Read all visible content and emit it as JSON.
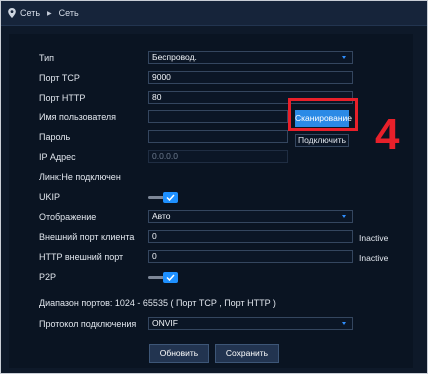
{
  "breadcrumb": {
    "icon": "location-pin-icon",
    "items": [
      "Сеть",
      "Сеть"
    ]
  },
  "form": {
    "type": {
      "label": "Тип",
      "value": "Беспровод."
    },
    "tcp_port": {
      "label": "Порт TCP",
      "value": "9000"
    },
    "http_port": {
      "label": "Порт HTTP",
      "value": "80"
    },
    "username": {
      "label": "Имя пользователя",
      "value": ""
    },
    "password": {
      "label": "Пароль",
      "value": ""
    },
    "ip_address": {
      "label": "IP Адрес",
      "value": "0.0.0.0"
    },
    "link_status": "Линк:Не подключен",
    "ukip": {
      "label": "UKIP",
      "enabled": true
    },
    "display": {
      "label": "Отображение",
      "value": "Авто"
    },
    "client_ext_port": {
      "label": "Внешний порт клиента",
      "value": "0",
      "status": "Inactive"
    },
    "http_ext_port": {
      "label": "HTTP внешний порт",
      "value": "0",
      "status": "Inactive"
    },
    "p2p": {
      "label": "P2P",
      "enabled": true
    },
    "port_range_note": "Диапазон портов: 1024 - 65535 ( Порт TCP , Порт HTTP )",
    "protocol": {
      "label": "Протокол подключения",
      "value": "ONVIF"
    }
  },
  "buttons": {
    "scan": "Сканирование",
    "connect": "Подключить",
    "refresh": "Обновить",
    "save": "Сохранить"
  },
  "annotation": {
    "number": "4",
    "color": "#e8202a"
  },
  "colors": {
    "background": "#0e1929",
    "accent": "#1e90ff",
    "scan_button": "#2b8ae6"
  }
}
